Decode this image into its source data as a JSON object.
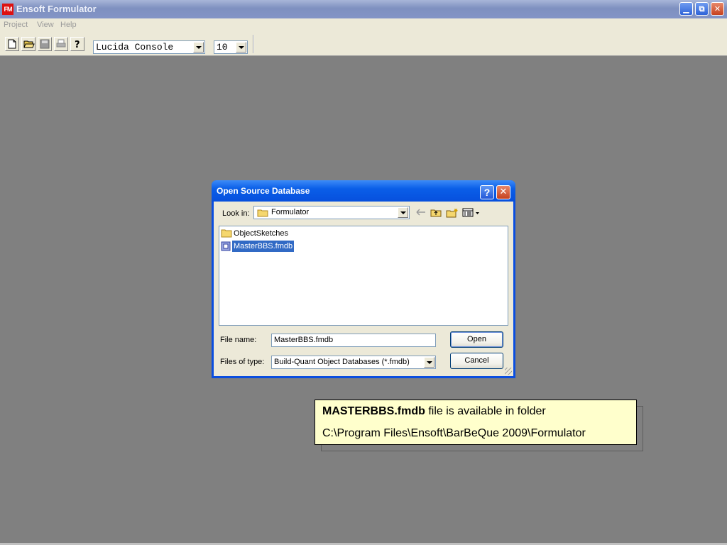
{
  "app": {
    "title": "Ensoft Formulator",
    "icon_text": "FM"
  },
  "window_controls": {
    "minimize": "minimize-icon",
    "restore": "restore-icon",
    "close": "close-icon"
  },
  "menu": {
    "items": [
      "Project",
      "View",
      "Help"
    ]
  },
  "toolbar": {
    "buttons": [
      "new-document-icon",
      "open-folder-icon",
      "save-icon",
      "print-icon",
      "help-icon"
    ],
    "font_name": "Lucida Console",
    "font_size": "10"
  },
  "dialog": {
    "title": "Open Source Database",
    "help_glyph": "?",
    "look_in_label": "Look in:",
    "look_in_value": "Formulator",
    "files": [
      {
        "name": "ObjectSketches",
        "type": "folder",
        "selected": false
      },
      {
        "name": "MasterBBS.fmdb",
        "type": "database",
        "selected": true
      }
    ],
    "file_name_label": "File name:",
    "file_name_value": "MasterBBS.fmdb",
    "files_of_type_label": "Files of type:",
    "files_of_type_value": "Build-Quant Object Databases (*.fmdb)",
    "open_label": "Open",
    "cancel_label": "Cancel"
  },
  "note": {
    "bold": "MASTERBBS.fmdb",
    "line1_rest": " file is available in folder",
    "line2": "C:\\Program Files\\Ensoft\\BarBeQue 2009\\Formulator"
  },
  "colors": {
    "desktop": "#808080",
    "dialog_frame": "#0a4ee0",
    "selection": "#316ac5",
    "note_bg": "#ffffcc"
  }
}
